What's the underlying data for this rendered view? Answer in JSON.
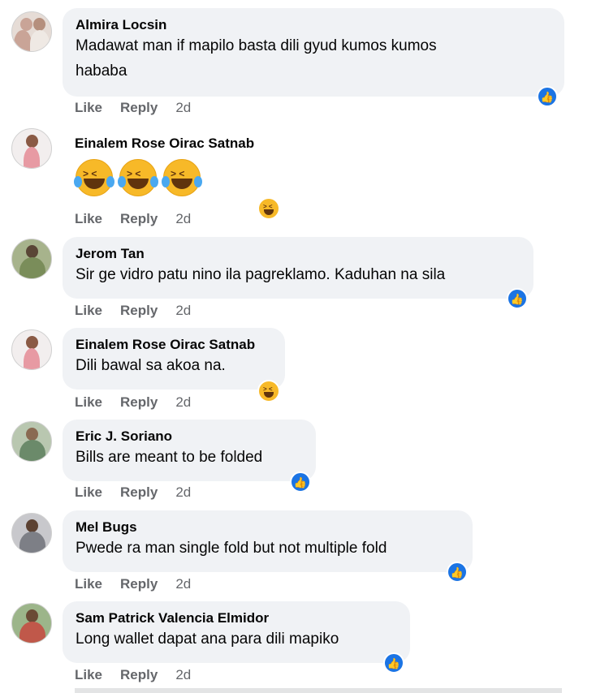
{
  "actions": {
    "like": "Like",
    "reply": "Reply"
  },
  "comments": [
    {
      "name": "Almira Locsin",
      "text": [
        "Madawat man if mapilo basta dili gyud kumos kumos",
        "hababa"
      ],
      "time": "2d",
      "reaction": "like",
      "avatar_color": "#c9a497"
    },
    {
      "name": "Einalem Rose Oirac Satnab",
      "text": [],
      "emojis": [
        "rolling-on-floor-laughing-emoji",
        "rolling-on-floor-laughing-emoji",
        "rolling-on-floor-laughing-emoji"
      ],
      "time": "2d",
      "reaction": "haha",
      "avatar_color": "#e79aa3"
    },
    {
      "name": "Jerom Tan",
      "text": [
        "Sir ge vidro patu nino ila pagreklamo. Kaduhan na sila"
      ],
      "time": "2d",
      "reaction": "like",
      "avatar_color": "#7a8d5a"
    },
    {
      "name": "Einalem Rose Oirac Satnab",
      "text": [
        "Dili bawal sa akoa na."
      ],
      "time": "2d",
      "reaction": "haha",
      "avatar_color": "#e79aa3"
    },
    {
      "name": "Eric J. Soriano",
      "text": [
        "Bills are meant to be folded"
      ],
      "time": "2d",
      "reaction": "like",
      "avatar_color": "#6b8a6a"
    },
    {
      "name": "Mel Bugs",
      "text": [
        "Pwede ra man single fold but not multiple fold"
      ],
      "time": "2d",
      "reaction": "like",
      "avatar_color": "#7d7f86"
    },
    {
      "name": "Sam Patrick Valencia Elmidor",
      "text": [
        "Long wallet dapat ana para dili mapiko"
      ],
      "time": "2d",
      "reaction": "like",
      "avatar_color": "#4f7a3e"
    }
  ],
  "colors": {
    "bubble": "#f0f2f5",
    "like_blue": "#1b74e4",
    "haha_yellow": "#f7b928",
    "meta_gray": "#65676b"
  }
}
